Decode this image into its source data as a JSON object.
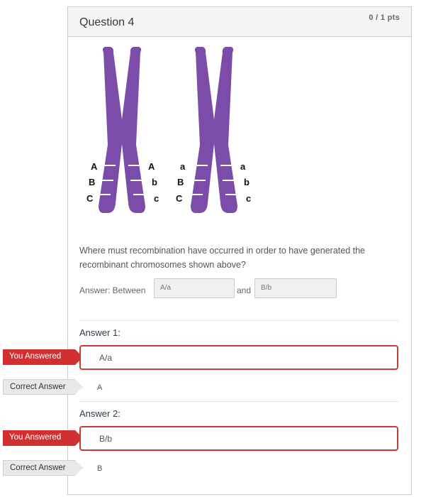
{
  "question": {
    "title": "Question 4",
    "points": "0 / 1 pts",
    "text": "Where must recombination have occurred in order to have generated the recombinant chromosomes shown above?",
    "answer_prefix": "Answer: Between",
    "blank1": "A/a",
    "connector": "and",
    "blank2": "B/b"
  },
  "figure": {
    "chromosome_color": "#7b4ca8",
    "band_color": "#ffffff",
    "chrom1": {
      "left_labels": [
        "A",
        "B",
        "C"
      ],
      "right_labels": [
        "A",
        "b",
        "c"
      ]
    },
    "chrom2": {
      "left_labels": [
        "a",
        "B",
        "C"
      ],
      "right_labels": [
        "a",
        "b",
        "c"
      ]
    }
  },
  "answers": [
    {
      "heading": "Answer 1:",
      "you_answered_label": "You Answered",
      "you_answered": "A/a",
      "correct_label": "Correct Answer",
      "correct": "A"
    },
    {
      "heading": "Answer 2:",
      "you_answered_label": "You Answered",
      "you_answered": "B/b",
      "correct_label": "Correct Answer",
      "correct": "B"
    }
  ],
  "colors": {
    "wrong": "#d22f31",
    "border": "#c7cdd1"
  }
}
